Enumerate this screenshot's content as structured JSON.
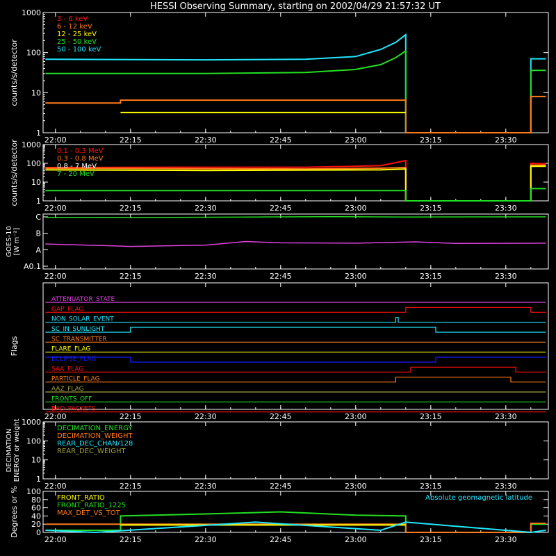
{
  "chart_data": {
    "type": "line",
    "title": "HESSI Observing Summary, starting on 2002/04/29 21:57:32 UT",
    "x_ticks": [
      "22:00",
      "22:15",
      "22:30",
      "22:45",
      "23:00",
      "23:15",
      "23:30"
    ],
    "colors": {
      "red": "#ff1010",
      "orange": "#ff7a1a",
      "yellow": "#ffff00",
      "green": "#22e022",
      "cyan": "#20e8ff",
      "magenta": "#e040e0",
      "blue": "#1a1aff",
      "olive": "#a0a040",
      "white": "#ffffff"
    },
    "panels": [
      {
        "id": "counts",
        "ylabel": "counts/s/detector",
        "y_scale": "log",
        "ylim": [
          1,
          1000
        ],
        "y_ticks": [
          "1",
          "10",
          "100",
          "1000"
        ],
        "legend": [
          {
            "label": "3 - 6 keV",
            "color": "red"
          },
          {
            "label": "6 - 12 keV",
            "color": "orange"
          },
          {
            "label": "12 - 25 keV",
            "color": "yellow"
          },
          {
            "label": "25 - 50 keV",
            "color": "green"
          },
          {
            "label": "50 - 100 keV",
            "color": "cyan"
          }
        ],
        "series": [
          {
            "color": "cyan",
            "x": [
              "21:58",
              "22:30",
              "22:50",
              "23:00",
              "23:05",
              "23:08",
              "23:10",
              "23:10",
              "23:35",
              "23:35",
              "23:38"
            ],
            "y": [
              68,
              66,
              68,
              80,
              120,
              180,
              280,
              1,
              1,
              70,
              70
            ]
          },
          {
            "color": "green",
            "x": [
              "21:58",
              "22:30",
              "22:50",
              "23:00",
              "23:05",
              "23:08",
              "23:10",
              "23:10",
              "23:35",
              "23:35",
              "23:38"
            ],
            "y": [
              30,
              30,
              32,
              38,
              50,
              75,
              110,
              1,
              1,
              36,
              36
            ]
          },
          {
            "color": "orange",
            "x": [
              "21:58",
              "22:13",
              "22:13",
              "23:10",
              "23:10",
              "23:35",
              "23:35",
              "23:38"
            ],
            "y": [
              5.5,
              5.5,
              6.5,
              6.5,
              1,
              1,
              8,
              8
            ]
          },
          {
            "color": "yellow",
            "x": [
              "22:13",
              "23:10"
            ],
            "y": [
              3.2,
              3.2
            ]
          }
        ]
      },
      {
        "id": "high-energy",
        "ylabel": "counts/s/detector",
        "y_scale": "log",
        "ylim": [
          1,
          1000
        ],
        "y_ticks": [
          "1",
          "10",
          "100",
          "1000"
        ],
        "legend": [
          {
            "label": "0.1 - 0.3 MeV",
            "color": "red"
          },
          {
            "label": "0.3 - 0.8 MeV",
            "color": "orange"
          },
          {
            "label": "0.8 - 7 MeV",
            "color": "white"
          },
          {
            "label": "7 - 20 MeV",
            "color": "green"
          }
        ],
        "series": [
          {
            "color": "red",
            "x": [
              "21:58",
              "22:30",
              "22:50",
              "23:05",
              "23:10",
              "23:10",
              "23:35",
              "23:35",
              "23:38"
            ],
            "y": [
              60,
              62,
              62,
              75,
              140,
              1,
              1,
              100,
              95
            ]
          },
          {
            "color": "orange",
            "x": [
              "21:58",
              "22:30",
              "22:50",
              "23:05",
              "23:10",
              "23:10",
              "23:35",
              "23:35",
              "23:38"
            ],
            "y": [
              55,
              52,
              50,
              55,
              60,
              1,
              1,
              80,
              80
            ]
          },
          {
            "color": "yellow",
            "x": [
              "21:58",
              "22:30",
              "23:05",
              "23:10",
              "23:10",
              "23:35",
              "23:35",
              "23:38"
            ],
            "y": [
              45,
              42,
              45,
              50,
              1,
              1,
              70,
              70
            ]
          },
          {
            "color": "green",
            "x": [
              "21:58",
              "22:30",
              "23:05",
              "23:10",
              "23:10",
              "23:35",
              "23:35",
              "23:38"
            ],
            "y": [
              3.5,
              3.5,
              3.5,
              3.5,
              1,
              1,
              4.5,
              4.5
            ]
          }
        ]
      },
      {
        "id": "goes",
        "ylabel_lines": [
          "GOES-10",
          "[W m⁻²]"
        ],
        "y_ticks": [
          "A0.1",
          "A",
          "B",
          "C"
        ],
        "series": [
          {
            "color": "green",
            "x": [
              "21:58",
              "22:20",
              "22:40",
              "22:55",
              "23:10",
              "23:38"
            ],
            "y": [
              2.97,
              2.96,
              2.99,
              3.01,
              2.99,
              3.0
            ]
          },
          {
            "color": "magenta",
            "x": [
              "21:58",
              "22:10",
              "22:15",
              "22:30",
              "22:38",
              "22:45",
              "23:00",
              "23:12",
              "23:20",
              "23:38"
            ],
            "y": [
              1.35,
              1.25,
              1.2,
              1.28,
              1.5,
              1.42,
              1.4,
              1.48,
              1.38,
              1.4
            ]
          }
        ]
      },
      {
        "id": "flags",
        "ylabel": "Flags",
        "rows": [
          {
            "label": "ATTENUATOR_STATE",
            "color": "magenta",
            "steps": [
              [
                "21:58",
                0
              ],
              [
                "23:38",
                0
              ]
            ]
          },
          {
            "label": "GAP_FLAG",
            "color": "red",
            "steps": [
              [
                "21:58",
                0
              ],
              [
                "23:10",
                1
              ],
              [
                "23:35",
                0
              ],
              [
                "23:38",
                0
              ]
            ]
          },
          {
            "label": "NON_SOLAR_EVENT",
            "color": "cyan",
            "steps": [
              [
                "21:58",
                0
              ],
              [
                "23:08",
                1
              ],
              [
                "23:08.5",
                0
              ],
              [
                "23:38",
                0
              ]
            ]
          },
          {
            "label": "SC_IN_SUNLIGHT",
            "color": "cyan",
            "steps": [
              [
                "21:58",
                0
              ],
              [
                "22:15",
                1
              ],
              [
                "23:16",
                0
              ],
              [
                "23:38",
                0
              ]
            ]
          },
          {
            "label": "SC_TRANSMITTER",
            "color": "orange",
            "steps": [
              [
                "21:58",
                0
              ],
              [
                "23:38",
                0
              ]
            ]
          },
          {
            "label": "FLARE_FLAG",
            "color": "yellow",
            "steps": [
              [
                "21:58",
                0
              ],
              [
                "23:38",
                0
              ]
            ]
          },
          {
            "label": "ECLIPSE_FLAG",
            "color": "blue",
            "steps": [
              [
                "21:58",
                1
              ],
              [
                "22:15",
                0
              ],
              [
                "23:16",
                1
              ],
              [
                "23:38",
                1
              ]
            ]
          },
          {
            "label": "SAA_FLAG",
            "color": "red",
            "steps": [
              [
                "21:58",
                0
              ],
              [
                "23:11",
                1
              ],
              [
                "23:32",
                0
              ],
              [
                "23:38",
                0
              ]
            ]
          },
          {
            "label": "PARTICLE_FLAG",
            "color": "orange",
            "steps": [
              [
                "21:58",
                0
              ],
              [
                "23:08",
                1
              ],
              [
                "23:31",
                0
              ],
              [
                "23:38",
                0
              ]
            ]
          },
          {
            "label": "AAZ_FLAG",
            "color": "olive",
            "steps": [
              [
                "21:58",
                0
              ],
              [
                "23:38",
                0
              ]
            ]
          },
          {
            "label": "FRONTS_OFF",
            "color": "green",
            "steps": [
              [
                "21:58",
                0
              ],
              [
                "23:38",
                0
              ]
            ]
          },
          {
            "label": "BAD_PACKETS",
            "color": "red",
            "steps": [
              [
                "21:58",
                0
              ],
              [
                "23:38",
                0
              ]
            ]
          }
        ]
      },
      {
        "id": "decimation",
        "ylabel_lines": [
          "DECIMATION",
          "ENERGY or weight"
        ],
        "y_scale": "log",
        "ylim": [
          1,
          1000
        ],
        "y_ticks": [
          "1",
          "10",
          "100",
          "1000"
        ],
        "legend": [
          {
            "label": "DECIMATION_ENERGY",
            "color": "green"
          },
          {
            "label": "DECIMATION_WEIGHT",
            "color": "orange"
          },
          {
            "label": "REAR_DEC_CHAN/128",
            "color": "cyan"
          },
          {
            "label": "REAR_DEC_WEIGHT",
            "color": "olive"
          }
        ],
        "series": []
      },
      {
        "id": "ratios",
        "ylabel": "Degrees or %",
        "ylim": [
          0,
          100
        ],
        "y_ticks": [
          "0",
          "20",
          "40",
          "60",
          "80",
          "100"
        ],
        "legend": [
          {
            "label": "FRONT_RATIO",
            "color": "yellow"
          },
          {
            "label": "FRONT_RATIO_1225",
            "color": "green"
          },
          {
            "label": "MAX_DET_VS_TOT",
            "color": "orange"
          }
        ],
        "right_note": "Absolute geomagnetic latitude",
        "series": [
          {
            "color": "green",
            "x": [
              "21:58",
              "22:13",
              "22:13",
              "22:30",
              "22:45",
              "23:00",
              "23:10",
              "23:10",
              "23:35",
              "23:35",
              "23:38"
            ],
            "y": [
              5,
              5,
              40,
              45,
              50,
              42,
              40,
              0,
              0,
              20,
              20
            ]
          },
          {
            "color": "orange",
            "x": [
              "21:58",
              "22:30",
              "23:10",
              "23:10",
              "23:35",
              "23:35",
              "23:38"
            ],
            "y": [
              20,
              20,
              20,
              0,
              0,
              22,
              22
            ]
          },
          {
            "color": "yellow",
            "x": [
              "22:13",
              "23:10"
            ],
            "y": [
              18,
              18
            ]
          },
          {
            "color": "cyan",
            "x": [
              "21:58",
              "22:08",
              "22:40",
              "23:05",
              "23:10",
              "23:25",
              "23:35",
              "23:38"
            ],
            "y": [
              5,
              0,
              25,
              5,
              25,
              10,
              0,
              5
            ]
          }
        ]
      }
    ]
  }
}
